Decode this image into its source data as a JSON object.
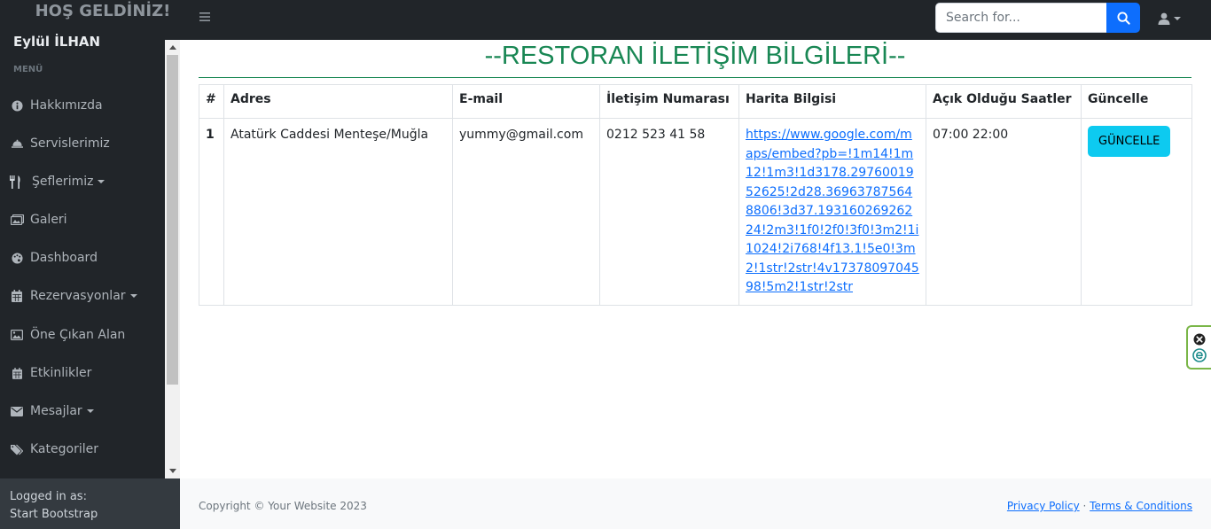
{
  "header": {
    "brand": "HOŞ GELDİNİZ!",
    "toggle_icon": "≡",
    "search": {
      "placeholder": "Search for...",
      "value": ""
    }
  },
  "sidebar": {
    "user_name": "Eylül İLHAN",
    "menu_heading": "MENÜ",
    "items": [
      {
        "label": "Hakkımızda",
        "icon": "info-icon",
        "has_caret": false
      },
      {
        "label": "Servislerimiz",
        "icon": "cloche-icon",
        "has_caret": false
      },
      {
        "label": "Şeflerimiz",
        "icon": "utensils-icon",
        "has_caret": true
      },
      {
        "label": "Galeri",
        "icon": "images-icon",
        "has_caret": false
      },
      {
        "label": "Dashboard",
        "icon": "palette-icon",
        "has_caret": false
      },
      {
        "label": "Rezervasyonlar",
        "icon": "calendar-icon",
        "has_caret": true
      },
      {
        "label": "Öne Çıkan Alan",
        "icon": "image-icon",
        "has_caret": false
      },
      {
        "label": "Etkinlikler",
        "icon": "calendar-small-icon",
        "has_caret": false
      },
      {
        "label": "Mesajlar",
        "icon": "envelope-icon",
        "has_caret": true
      },
      {
        "label": "Kategoriler",
        "icon": "tags-icon",
        "has_caret": false
      }
    ],
    "footer": {
      "logged_in_label": "Logged in as:",
      "user": "Start Bootstrap"
    }
  },
  "main": {
    "title": "--RESTORAN İLETİŞİM BİLGİLERİ--",
    "table": {
      "headers": [
        "#",
        "Adres",
        "E-mail",
        "İletişim Numarası",
        "Harita Bilgisi",
        "Açık Olduğu Saatler",
        "Güncelle"
      ],
      "rows": [
        {
          "id": "1",
          "address": "Atatürk Caddesi Menteşe/Muğla",
          "email": "yummy@gmail.com",
          "phone": "0212 523 41 58",
          "map": "https://www.google.com/maps/embed?pb=!1m14!1m12!1m3!1d3178.2976001952625!2d28.369637875648806!3d37.19316026926224!2m3!1f0!2f0!3f0!3m2!1i1024!2i768!4f13.1!5e0!3m2!1str!2str!4v1737809704598!5m2!1str!2str",
          "hours": "07:00 22:00",
          "button_label": "GÜNCELLE"
        }
      ]
    }
  },
  "footer": {
    "copyright": "Copyright © Your Website 2023",
    "privacy": "Privacy Policy",
    "separator": "·",
    "terms": "Terms & Conditions"
  },
  "colors": {
    "navbar_bg": "#212529",
    "title_green": "#198754",
    "search_button": "#0d6efd",
    "update_button": "#0dcaf0",
    "link": "#0d6efd"
  }
}
